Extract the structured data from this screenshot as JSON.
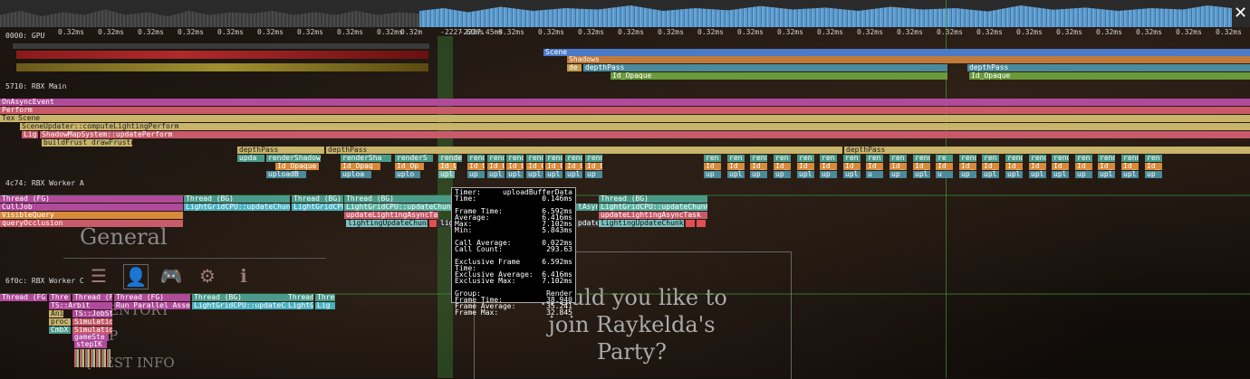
{
  "window": {
    "close_icon": "close-icon",
    "close_glyph": "✕"
  },
  "ruler": {
    "ticks": [
      "0.32ms",
      "0.32ms",
      "0.32ms",
      "0.32ms",
      "0.32ms",
      "0.32ms",
      "0.32ms",
      "0.32ms",
      "0.32ms",
      "0.32ms",
      "-2227.60ms",
      "-2227.45ms",
      "0.32ms",
      "0.32ms",
      "0.32ms",
      "0.32ms",
      "0.32ms",
      "0.32ms",
      "0.32ms",
      "0.32ms",
      "0.32ms",
      "0.32ms",
      "0.32ms",
      "0.32ms",
      "0.32ms",
      "0.32ms",
      "0.32ms",
      "0.32ms",
      "0.32ms",
      "0.32ms",
      "0.32ms"
    ],
    "truncated_tick": "0.32m"
  },
  "threads": {
    "gpu": "0000: GPU",
    "main": "5710: RBX Main",
    "worker_a": "4c74: RBX Worker A",
    "worker_c": "6f0c: RBX Worker C"
  },
  "gpu_bars": {
    "scene": "Scene",
    "shadows": "Shadows",
    "de": "de",
    "depth_pass_1": "depthPass",
    "depth_pass_2": "depthPass",
    "id_opaque_1": "Id_Opaque",
    "id_opaque_2": "Id_Opaque"
  },
  "main_bars": {
    "on_async_event": "OnAsyncEvent",
    "perform": "Perform",
    "tex": "Tex",
    "scene": "Scene",
    "scene_updater": "SceneUpdater::computeLightingPerform",
    "lig": "Lig",
    "shadow_map": "ShadowMapSystem::updatePerform",
    "build_frust": "buildFrust drawFrustums",
    "depth_pass_a": "depthPass",
    "depth_pass_b": "depthPass",
    "depth_pass_c": "depthPass",
    "upda": "upda",
    "render_shadow": "renderShadow",
    "id_opaque": "Id_Opaque",
    "upload_b": "uploadB",
    "render_sha": "renderSha",
    "id_opaq": "Id_Opaq",
    "uploa": "uploa",
    "render_s": "renderS",
    "id_op": "Id_Op",
    "uplo": "uplo",
    "render_sel": "render",
    "id_u": "Id_U",
    "upl_sel": "upl"
  },
  "render_cells": [
    {
      "top": "rende",
      "mid": "Id_U",
      "bot": "up"
    },
    {
      "top": "rende",
      "mid": "Id_U",
      "bot": "upl"
    },
    {
      "top": "render",
      "mid": "Id_U",
      "bot": "upl"
    },
    {
      "top": "rende",
      "mid": "Id_O",
      "bot": "upl"
    },
    {
      "top": "rende",
      "mid": "Id_O",
      "bot": "upl"
    },
    {
      "top": "rende",
      "mid": "Id_U",
      "bot": "upl"
    },
    {
      "top": "rende",
      "mid": "Id_O",
      "bot": "up"
    },
    {
      "top": "ren",
      "mid": "Id_",
      "bot": "up"
    },
    {
      "top": "ren",
      "mid": "Id_",
      "bot": "upl"
    },
    {
      "top": "rend",
      "mid": "Id_",
      "bot": "up"
    },
    {
      "top": "ren",
      "mid": "Id_",
      "bot": "up"
    },
    {
      "top": "ren",
      "mid": "Id_",
      "bot": "upl"
    },
    {
      "top": "ren",
      "mid": "Id_",
      "bot": "up"
    },
    {
      "top": "ren",
      "mid": "Id_",
      "bot": "upl"
    },
    {
      "top": "ren",
      "mid": "Id_",
      "bot": "u"
    },
    {
      "top": "ren",
      "mid": "Id_",
      "bot": "up"
    },
    {
      "top": "rend",
      "mid": "Id_",
      "bot": "upl"
    },
    {
      "top": "re",
      "mid": "Id",
      "bot": "u"
    },
    {
      "top": "rend",
      "mid": "Id_",
      "bot": "up"
    },
    {
      "top": "ren",
      "mid": "Id_",
      "bot": "upl"
    },
    {
      "top": "rend",
      "mid": "Id_",
      "bot": "upl"
    },
    {
      "top": "rend",
      "mid": "Id_",
      "bot": "upl"
    },
    {
      "top": "rend",
      "mid": "Id_",
      "bot": "upl"
    },
    {
      "top": "ren",
      "mid": "Id_",
      "bot": "up"
    },
    {
      "top": "rend",
      "mid": "Id_",
      "bot": "upl"
    },
    {
      "top": "rend",
      "mid": "Id_",
      "bot": "upl"
    },
    {
      "top": "ren",
      "mid": "Id_",
      "bot": "up"
    }
  ],
  "worker_a_bars": {
    "thread_fg": "Thread (FG)",
    "cull_job": "CullJob",
    "visible_query": "VisibleQuery",
    "query_occlusion": "queryOcclusion",
    "thread_bg_1": "Thread (BG)",
    "light_grid_1": "LightGridCPU::updateChunkO",
    "thread_bg_2": "Thread (BG)",
    "light_grid_2": "LightGridCPU",
    "thread_bg_3": "Thread (BG)",
    "light_grid_3": "LightGridCPU::updateChunk",
    "update_lighting": "updateLightingAsyncTask",
    "lighting_update_chunk": "lightingUpdateChunk",
    "lig": "lig",
    "async_partial": "tAsyn",
    "update_partial": "pdate",
    "thread_bg_4": "Thread (BG)",
    "light_grid_4": "LightGridCPU::updateChunkO",
    "update_lighting_2": "updateLightingAsyncTask",
    "lighting_update_chunk_2": "lightingUpdateChunkLo"
  },
  "worker_c_bars": {
    "thread_fg": "Thread (FG)",
    "thre": "Thre",
    "thread_f": "Thread (F",
    "thread_fg_2": "Thread (FG)",
    "thread_bg": "Thread (BG)",
    "thread_short": "Thread",
    "thre_2": "Thre",
    "ts_arbit": "TS::Arbit",
    "run_parallel": "Run Parallel Assem",
    "light_grid": "LightGridCPU::updateChu",
    "light_g": "LightG",
    "lig": "Lig",
    "ts_jobst": "TS::JobSt",
    "anim": "Anim",
    "proc": "proc",
    "simulatio_1": "Simulatio",
    "cmbx": "CmbX",
    "simulatio_2": "Simulatio",
    "game_ste": "gameSte",
    "step_ik": "stepIK"
  },
  "tooltip": {
    "timer_label": "Timer:",
    "timer_value": "uploadBufferData",
    "time_label": "Time:",
    "time_value": "0.146ms",
    "frame_time_label": "Frame Time:",
    "frame_time_value": "6.592ms",
    "average_label": "Average:",
    "average_value": "6.416ms",
    "max_label": "Max:",
    "max_value": "7.102ms",
    "min_label": "Min:",
    "min_value": "5.843ms",
    "call_average_label": "Call Average:",
    "call_average_value": "0.022ms",
    "call_count_label": "Call Count:",
    "call_count_value": "293.63",
    "excl_frame_label": "Exclusive Frame Time:",
    "excl_frame_value": "6.592ms",
    "excl_avg_label": "Exclusive Average:",
    "excl_avg_value": "6.416ms",
    "excl_max_label": "Exclusive Max:",
    "excl_max_value": "7.102ms",
    "group_label": "Group:",
    "group_value": "Render",
    "g_frame_label": "Frame Time:",
    "g_frame_value": "38.940",
    "g_avg_label": "Frame Average:",
    "g_avg_value": "35.241",
    "g_max_label": "Frame Max:",
    "g_max_value": "32.845"
  },
  "game_ui": {
    "menu_title": "General",
    "menu_icons": [
      "list-icon",
      "character-icon",
      "gamepad-icon",
      "gear-icon",
      "info-icon"
    ],
    "menu_glyphs": [
      "☰",
      "👤",
      "🎮",
      "⚙",
      "ℹ"
    ],
    "menu_items": [
      "ENTORY",
      "P",
      "QUEST INFO"
    ],
    "party_prompt_line1": "Would you like to",
    "party_prompt_line2": "join Raykelda's",
    "party_prompt_line3": "Party?"
  },
  "colors": {
    "purple": "#b04a9a",
    "pink": "#c85a6a",
    "khaki": "#c8b46a",
    "teal": "#4a9a8a",
    "blue": "#4a7ac8",
    "orange": "#d88a3a",
    "green": "#5a9a4a",
    "sky": "#6aa6d6"
  }
}
